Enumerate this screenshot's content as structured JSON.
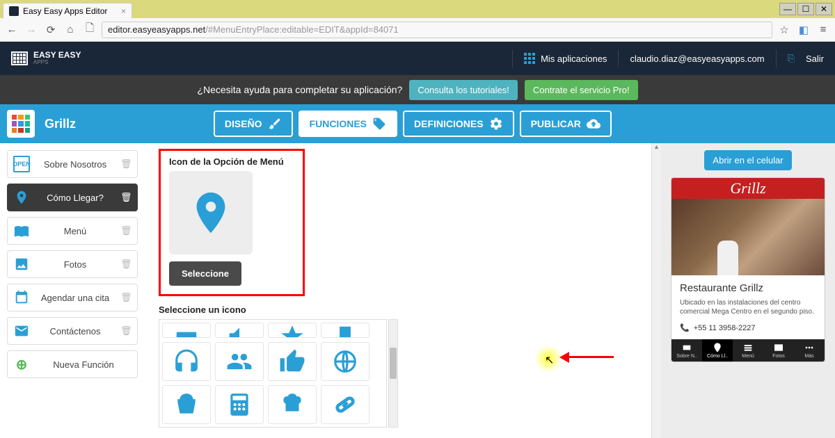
{
  "browser": {
    "tab_title": "Easy Easy Apps Editor",
    "url_host": "editor.easyeasyapps.net",
    "url_path": "/#MenuEntryPlace:editable=EDIT&appId=84071"
  },
  "header": {
    "brand_top": "EASY EASY",
    "brand_sub": "APPS",
    "my_apps": "Mis aplicaciones",
    "user_email": "claudio.diaz@easyeasyapps.com",
    "logout": "Salir"
  },
  "help_bar": {
    "question": "¿Necesita ayuda para completar su aplicación?",
    "tutorials": "Consulta los tutoriales!",
    "pro": "Contrate el servicio Pro!"
  },
  "blue_bar": {
    "app_name": "Grillz",
    "tabs": {
      "design": "DISEÑO",
      "functions": "FUNCIONES",
      "definitions": "DEFINICIONES",
      "publish": "PUBLICAR"
    }
  },
  "sidebar": {
    "items": [
      {
        "label": "Sobre Nosotros"
      },
      {
        "label": "Cómo Llegar?"
      },
      {
        "label": "Menú"
      },
      {
        "label": "Fotos"
      },
      {
        "label": "Agendar una cita"
      },
      {
        "label": "Contáctenos"
      }
    ],
    "new_function": "Nueva Función"
  },
  "content": {
    "icon_section_title": "Icon de la Opción de Menú",
    "select_btn": "Seleccione",
    "pick_icon_title": "Seleccione un icono"
  },
  "preview": {
    "open_mobile": "Abrir en el celular",
    "brand": "Grillz",
    "title": "Restaurante Grillz",
    "desc": "Ubicado en las instalaciones del centro comercial Mega Centro en el segundo piso.",
    "phone": "+55 11 3958-2227",
    "tabs": [
      "Sobre N..",
      "Cómo Ll..",
      "Menú",
      "Fotos",
      "Más"
    ]
  }
}
